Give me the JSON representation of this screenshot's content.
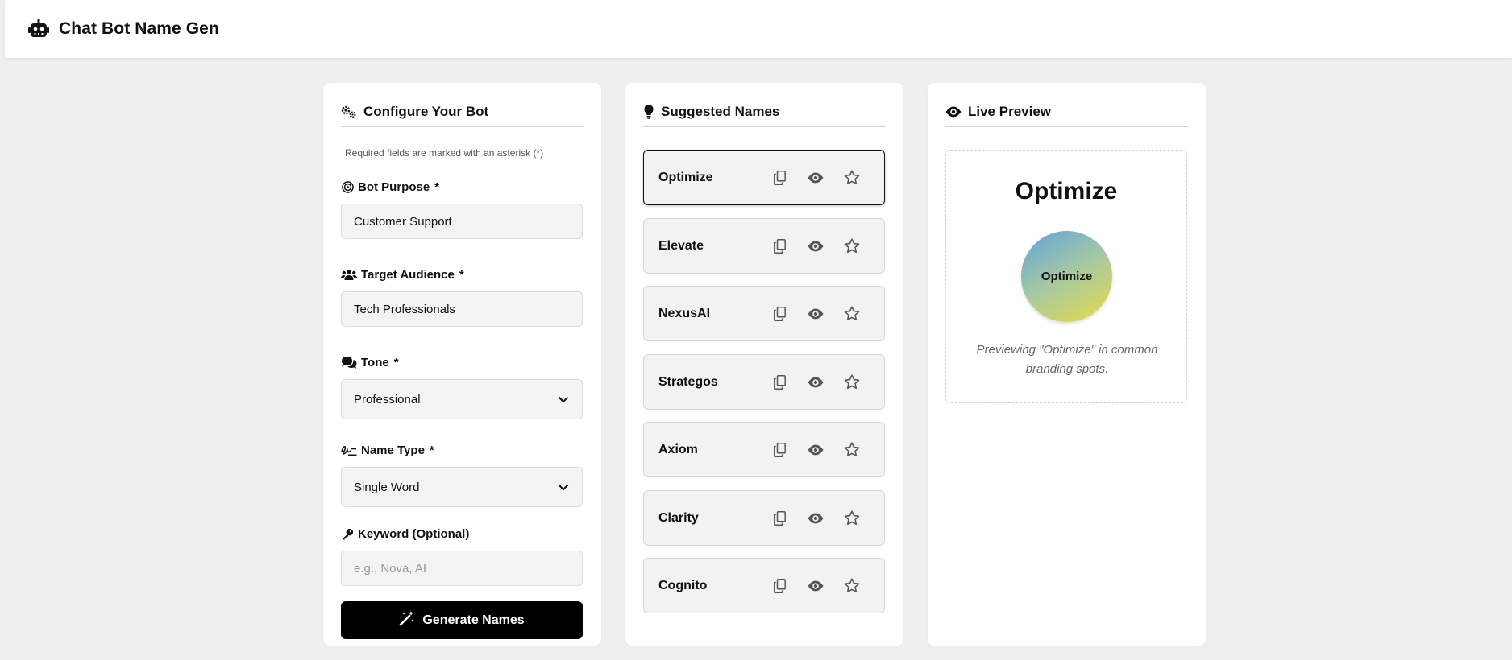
{
  "app": {
    "title": "Chat Bot Name Gen",
    "logo_icon": "robot-icon"
  },
  "config": {
    "heading": "Configure Your Bot",
    "heading_icon": "gears-icon",
    "required_note": "Required fields are marked with an asterisk (*)",
    "fields": {
      "purpose": {
        "label": "Bot Purpose",
        "required": "*",
        "icon": "target-icon",
        "value": "Customer Support"
      },
      "audience": {
        "label": "Target Audience",
        "required": "*",
        "icon": "users-icon",
        "value": "Tech Professionals"
      },
      "tone": {
        "label": "Tone",
        "required": "*",
        "icon": "comments-icon",
        "value": "Professional"
      },
      "name_type": {
        "label": "Name Type",
        "required": "*",
        "icon": "signature-icon",
        "value": "Single Word"
      },
      "keyword": {
        "label": "Keyword (Optional)",
        "icon": "key-icon",
        "placeholder": "e.g., Nova, AI",
        "value": ""
      }
    },
    "generate_label": "Generate Names",
    "generate_icon": "magic-wand-icon"
  },
  "suggestions": {
    "heading": "Suggested Names",
    "heading_icon": "lightbulb-icon",
    "selected_index": 0,
    "names": [
      "Optimize",
      "Elevate",
      "NexusAI",
      "Strategos",
      "Axiom",
      "Clarity",
      "Cognito"
    ],
    "action_icons": [
      "copy-icon",
      "eye-icon",
      "star-icon"
    ]
  },
  "preview": {
    "heading": "Live Preview",
    "heading_icon": "eye-icon",
    "name": "Optimize",
    "avatar_text": "Optimize",
    "caption": "Previewing \"Optimize\" in common branding spots.",
    "gradient": [
      "#5fa3dd",
      "#e6dc4a"
    ]
  },
  "colors": {
    "page_bg": "#efefef",
    "panel_bg": "#ffffff",
    "button_bg": "#000000",
    "card_bg": "#f2f2f2"
  }
}
